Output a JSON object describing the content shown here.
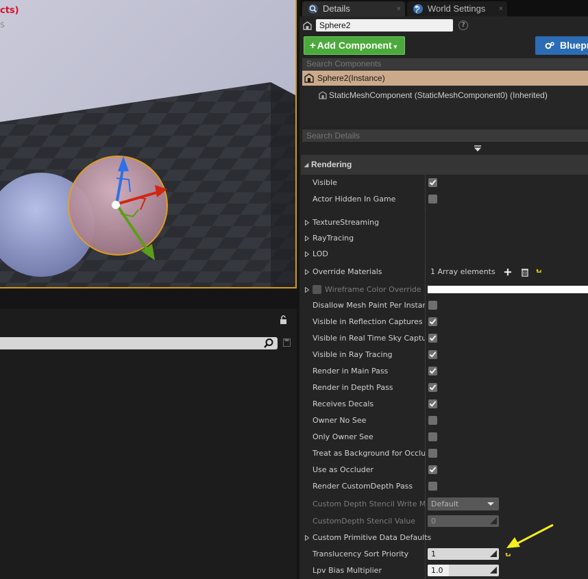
{
  "viewport": {
    "overlay_line1": "cts)",
    "overlay_line2": "s"
  },
  "tabs": [
    {
      "label": "Details",
      "icon": "details-magnifier-icon",
      "close": "×"
    },
    {
      "label": "World Settings",
      "icon": "globe-icon",
      "close": "×"
    }
  ],
  "actor": {
    "name": "Sphere2",
    "help": "?"
  },
  "toolbar": {
    "add_component_plus": "+",
    "add_component_label": "Add Component",
    "add_component_caret": "▾",
    "blueprint_label": "Bluepr"
  },
  "components": {
    "search_placeholder": "Search Components",
    "root": "Sphere2(Instance)",
    "child": "StaticMeshComponent (StaticMeshComponent0) (Inherited)"
  },
  "details_search_placeholder": "Search Details",
  "rendering": {
    "category": "Rendering",
    "visible": {
      "label": "Visible",
      "checked": true
    },
    "actor_hidden": {
      "label": "Actor Hidden In Game",
      "checked": false
    }
  },
  "mesh": {
    "texture_streaming": "TextureStreaming",
    "ray_tracing": "RayTracing",
    "lod": "LOD",
    "override_materials": {
      "label": "Override Materials",
      "value": "1 Array elements"
    },
    "wireframe_color": "Wireframe Color Override",
    "checkboxes": [
      {
        "label": "Disallow Mesh Paint Per Instance",
        "checked": false
      },
      {
        "label": "Visible in Reflection Captures",
        "checked": true
      },
      {
        "label": "Visible in Real Time Sky Captures",
        "checked": true
      },
      {
        "label": "Visible in Ray Tracing",
        "checked": true
      },
      {
        "label": "Render in Main Pass",
        "checked": true
      },
      {
        "label": "Render in Depth Pass",
        "checked": true
      },
      {
        "label": "Receives Decals",
        "checked": true
      },
      {
        "label": "Owner No See",
        "checked": false
      },
      {
        "label": "Only Owner See",
        "checked": false
      },
      {
        "label": "Treat as Background for Occlusion",
        "checked": false
      },
      {
        "label": "Use as Occluder",
        "checked": true
      },
      {
        "label": "Render CustomDepth Pass",
        "checked": false
      }
    ],
    "stencil_write_mask": {
      "label": "Custom Depth Stencil Write Mask",
      "value": "Default"
    },
    "stencil_value": {
      "label": "CustomDepth Stencil Value",
      "value": "0"
    },
    "primitive_data": "Custom Primitive Data Defaults",
    "translucency": {
      "label": "Translucency Sort Priority",
      "value": "1"
    },
    "lpv_bias": {
      "label": "Lpv Bias Multiplier",
      "value": "1.0",
      "fill_fraction": 0.3
    }
  },
  "colors": {
    "selection_border": "#d39a1c",
    "add_component_green": "#4caa3c",
    "blueprint_blue": "#2b6cb5",
    "selected_row": "#cba98b",
    "annotation_yellow": "#f5f01a",
    "reset_yellow": "#e8d31c"
  }
}
